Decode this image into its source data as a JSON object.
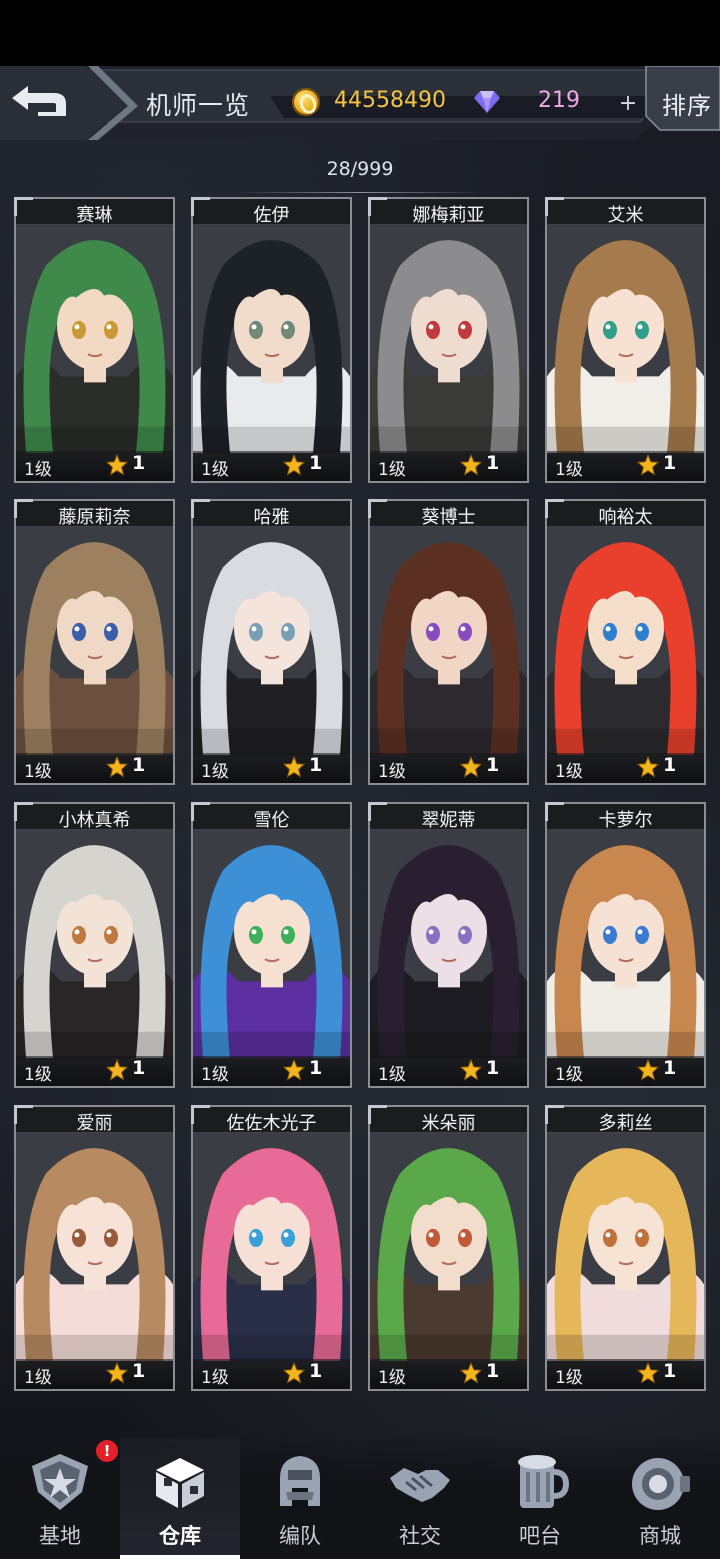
{
  "header": {
    "title": "机师一览",
    "gold": "44558490",
    "gems": "219",
    "add_label": "+",
    "sort_label": "排序"
  },
  "roster": {
    "count": "28/999"
  },
  "cards": [
    {
      "name": "赛琳",
      "level": "1级",
      "stars": "1",
      "hair": "#3f8a4a",
      "skin": "#f2d9c4",
      "cloth": "#2a2e2a",
      "eye": "#c99a33"
    },
    {
      "name": "佐伊",
      "level": "1级",
      "stars": "1",
      "hair": "#1d2228",
      "skin": "#f1dccb",
      "cloth": "#e8eaee",
      "eye": "#6f8a7a"
    },
    {
      "name": "娜梅莉亚",
      "level": "1级",
      "stars": "1",
      "hair": "#8c8c8e",
      "skin": "#efdcd0",
      "cloth": "#3a3a36",
      "eye": "#c0393b"
    },
    {
      "name": "艾米",
      "level": "1级",
      "stars": "1",
      "hair": "#a57a4d",
      "skin": "#f6e1d2",
      "cloth": "#f0eee8",
      "eye": "#2fa08a"
    },
    {
      "name": "藤原莉奈",
      "level": "1级",
      "stars": "1",
      "hair": "#9c8060",
      "skin": "#f0d8c6",
      "cloth": "#6b5040",
      "eye": "#3a5ea8"
    },
    {
      "name": "哈雅",
      "level": "1级",
      "stars": "1",
      "hair": "#d8dbe0",
      "skin": "#f4e4dc",
      "cloth": "#202024",
      "eye": "#7aa0b8"
    },
    {
      "name": "葵博士",
      "level": "1级",
      "stars": "1",
      "hair": "#5b2f22",
      "skin": "#f1d6c6",
      "cloth": "#2c2a2e",
      "eye": "#8a4ac0"
    },
    {
      "name": "响裕太",
      "level": "1级",
      "stars": "1",
      "hair": "#e8402c",
      "skin": "#f6dfca",
      "cloth": "#2b2b2e",
      "eye": "#2f7fd0"
    },
    {
      "name": "小林真希",
      "level": "1级",
      "stars": "1",
      "hair": "#d6d4cf",
      "skin": "#f3e2d6",
      "cloth": "#2a2526",
      "eye": "#c07a40"
    },
    {
      "name": "雪伦",
      "level": "1级",
      "stars": "1",
      "hair": "#3d8fd6",
      "skin": "#f6e0d2",
      "cloth": "#5b2fa0",
      "eye": "#3fb05a"
    },
    {
      "name": "翠妮蒂",
      "level": "1级",
      "stars": "1",
      "hair": "#2a1f30",
      "skin": "#ece0e6",
      "cloth": "#1c1c22",
      "eye": "#8a70c0"
    },
    {
      "name": "卡萝尔",
      "level": "1级",
      "stars": "1",
      "hair": "#c8874e",
      "skin": "#f6e2d4",
      "cloth": "#f0ece6",
      "eye": "#3a7ad0"
    },
    {
      "name": "爱丽",
      "level": "1级",
      "stars": "1",
      "hair": "#b88a62",
      "skin": "#f6e2d6",
      "cloth": "#f4dcd8",
      "eye": "#9a5a3a"
    },
    {
      "name": "佐佐木光子",
      "level": "1级",
      "stars": "1",
      "hair": "#e86a96",
      "skin": "#f6e0d6",
      "cloth": "#2a2f48",
      "eye": "#3aa0d8"
    },
    {
      "name": "米朵丽",
      "level": "1级",
      "stars": "1",
      "hair": "#5aa84a",
      "skin": "#f2ddcc",
      "cloth": "#4a3a30",
      "eye": "#c05a3a"
    },
    {
      "name": "多莉丝",
      "level": "1级",
      "stars": "1",
      "hair": "#e6b65a",
      "skin": "#f7e3d4",
      "cloth": "#f0dcdc",
      "eye": "#c0703a"
    }
  ],
  "nav": [
    {
      "label": "基地",
      "icon": "base-icon",
      "badge": "!"
    },
    {
      "label": "仓库",
      "icon": "warehouse-icon",
      "active": true
    },
    {
      "label": "编队",
      "icon": "formation-icon"
    },
    {
      "label": "社交",
      "icon": "handshake-icon"
    },
    {
      "label": "吧台",
      "icon": "bar-icon"
    },
    {
      "label": "商城",
      "icon": "shop-icon"
    }
  ],
  "colors": {
    "gold": "#f4c543",
    "gem": "#f0a6e7",
    "star": "#f3b51c",
    "badge": "#e3202a"
  }
}
